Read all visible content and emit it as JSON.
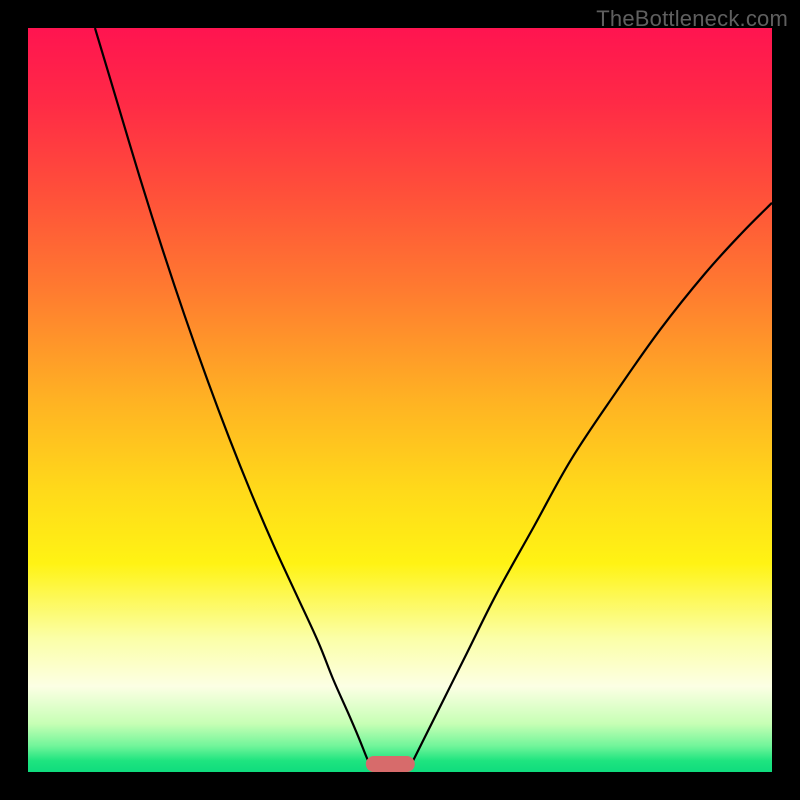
{
  "watermark": "TheBottleneck.com",
  "gradient_stops": [
    {
      "offset": 0.0,
      "color": "#ff1450"
    },
    {
      "offset": 0.1,
      "color": "#ff2a46"
    },
    {
      "offset": 0.22,
      "color": "#ff4f3a"
    },
    {
      "offset": 0.35,
      "color": "#ff7a30"
    },
    {
      "offset": 0.5,
      "color": "#ffb223"
    },
    {
      "offset": 0.62,
      "color": "#ffd91a"
    },
    {
      "offset": 0.72,
      "color": "#fff314"
    },
    {
      "offset": 0.82,
      "color": "#fbffa7"
    },
    {
      "offset": 0.885,
      "color": "#fcffe4"
    },
    {
      "offset": 0.935,
      "color": "#c7ffb5"
    },
    {
      "offset": 0.965,
      "color": "#71f59a"
    },
    {
      "offset": 0.985,
      "color": "#1ee47f"
    },
    {
      "offset": 1.0,
      "color": "#0fdc7e"
    }
  ],
  "chart_data": {
    "type": "line",
    "title": "",
    "xlabel": "",
    "ylabel": "",
    "xlim": [
      0,
      100
    ],
    "ylim": [
      0,
      100
    ],
    "grid": false,
    "legend": false,
    "series": [
      {
        "name": "left-curve",
        "x": [
          9,
          12,
          15,
          18,
          21,
          24,
          27,
          30,
          33,
          36,
          39,
          41,
          43,
          44.5,
          45.5,
          46.2
        ],
        "y": [
          100,
          90,
          80,
          70.5,
          61.5,
          53,
          45,
          37.5,
          30.5,
          24,
          17.5,
          12.5,
          8,
          4.5,
          2,
          0.5
        ]
      },
      {
        "name": "right-curve",
        "x": [
          51.2,
          52,
          53.5,
          56,
          59,
          63,
          68,
          73,
          79,
          85,
          91,
          96,
          100
        ],
        "y": [
          0.5,
          2,
          5,
          10,
          16,
          24,
          33,
          42,
          51,
          59.5,
          67,
          72.5,
          76.5
        ]
      }
    ],
    "marker": {
      "x_center": 48.7,
      "width": 6.5,
      "color": "#d76b6b"
    }
  }
}
